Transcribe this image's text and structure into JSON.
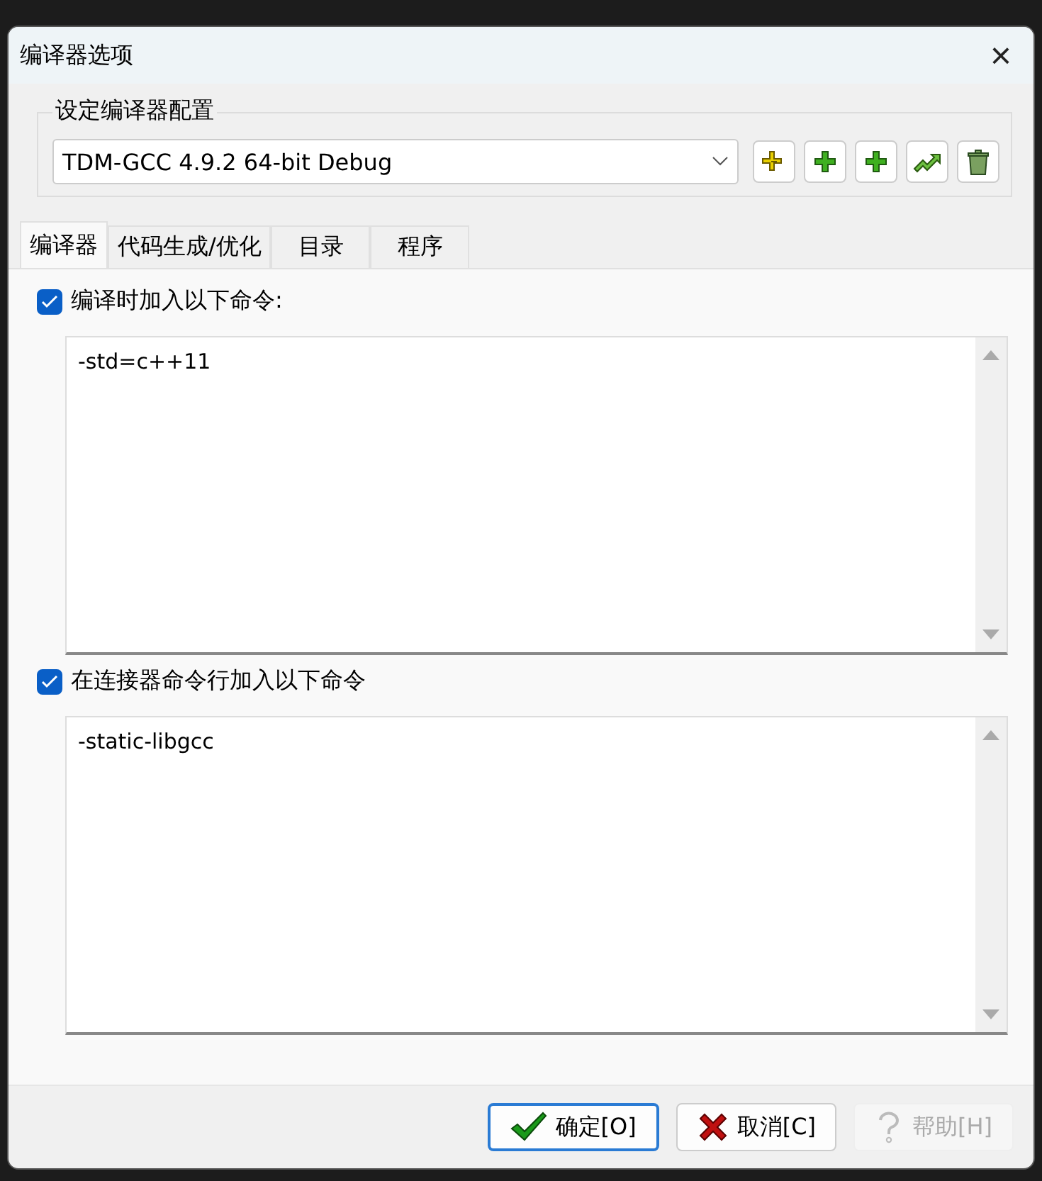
{
  "window": {
    "title": "编译器选项",
    "close": "×"
  },
  "config_group": {
    "title": "设定编译器配置",
    "selected_config": "TDM-GCC 4.9.2 64-bit Debug"
  },
  "tabs": [
    {
      "label": "编译器",
      "selected": true
    },
    {
      "label": "代码生成/优化",
      "selected": false
    },
    {
      "label": "目录",
      "selected": false
    },
    {
      "label": "程序",
      "selected": false
    }
  ],
  "sections": [
    {
      "label": "编译时加入以下命令:",
      "checked": true,
      "value": "-std=c++11"
    },
    {
      "label": "在连接器命令行加入以下命令",
      "checked": true,
      "value": "-static-libgcc"
    }
  ],
  "buttons": [
    {
      "label": "确定[O]",
      "kind": "ok",
      "disabled": false,
      "focused": true
    },
    {
      "label": "取消[C]",
      "kind": "cancel",
      "disabled": false,
      "focused": false
    },
    {
      "label": "帮助[H]",
      "kind": "help",
      "disabled": true,
      "focused": false
    }
  ]
}
